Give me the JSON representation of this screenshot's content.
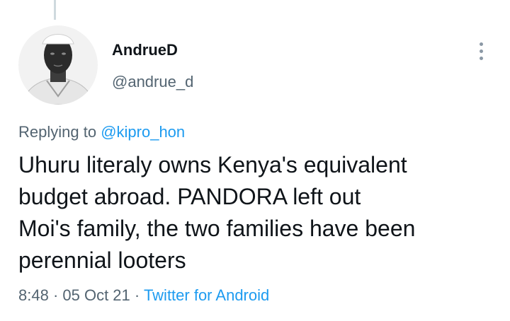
{
  "thread": {
    "connector": "thread-connector-line"
  },
  "author": {
    "name": "AndrueD",
    "handle": "@andrue_d",
    "avatar": "profile-photo-bw"
  },
  "more_menu": {
    "icon": "vertical-ellipsis-icon"
  },
  "reply": {
    "prefix": "Replying to ",
    "mention": "@kipro_hon"
  },
  "tweet": {
    "lines": [
      "Uhuru literaly owns Kenya's equivalent",
      "budget abroad. PANDORA left out",
      "Moi's family, the two families have been",
      "perennial looters"
    ]
  },
  "meta": {
    "time": "8:48",
    "sep1": " · ",
    "date": "05 Oct 21",
    "sep2": " · ",
    "source": "Twitter for Android"
  },
  "colors": {
    "text": "#0f1419",
    "secondary": "#536471",
    "link": "#1d9bf0"
  }
}
